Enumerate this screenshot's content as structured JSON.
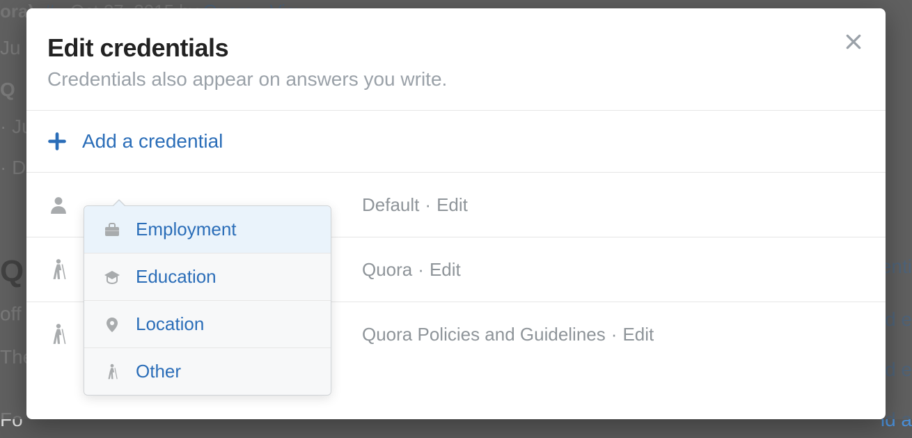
{
  "background": {
    "line1_fragments": [
      "ora).",
      "#",
      "· Oct 27, 2015 by",
      "Quora",
      "·",
      "View"
    ],
    "left_snips": [
      "Ju",
      "Q",
      "· Ju",
      "· D"
    ],
    "q_heading": "Q",
    "off": "off",
    "the": "The",
    "for": "Fo",
    "right_snips": [
      "enti",
      "ld e",
      "ld e",
      "ld a"
    ]
  },
  "modal": {
    "title": "Edit credentials",
    "subtitle": "Credentials also appear on answers you write.",
    "add_label": "Add a credential",
    "rows": [
      {
        "icon": "person",
        "text": "Default",
        "edit": "Edit"
      },
      {
        "icon": "walk",
        "text": "Quora",
        "edit": "Edit"
      },
      {
        "icon": "walk",
        "text": "Quora Policies and Guidelines",
        "edit": "Edit"
      }
    ]
  },
  "dropdown": {
    "items": [
      {
        "icon": "briefcase",
        "label": "Employment"
      },
      {
        "icon": "gradcap",
        "label": "Education"
      },
      {
        "icon": "pin",
        "label": "Location"
      },
      {
        "icon": "walk",
        "label": "Other"
      }
    ]
  }
}
